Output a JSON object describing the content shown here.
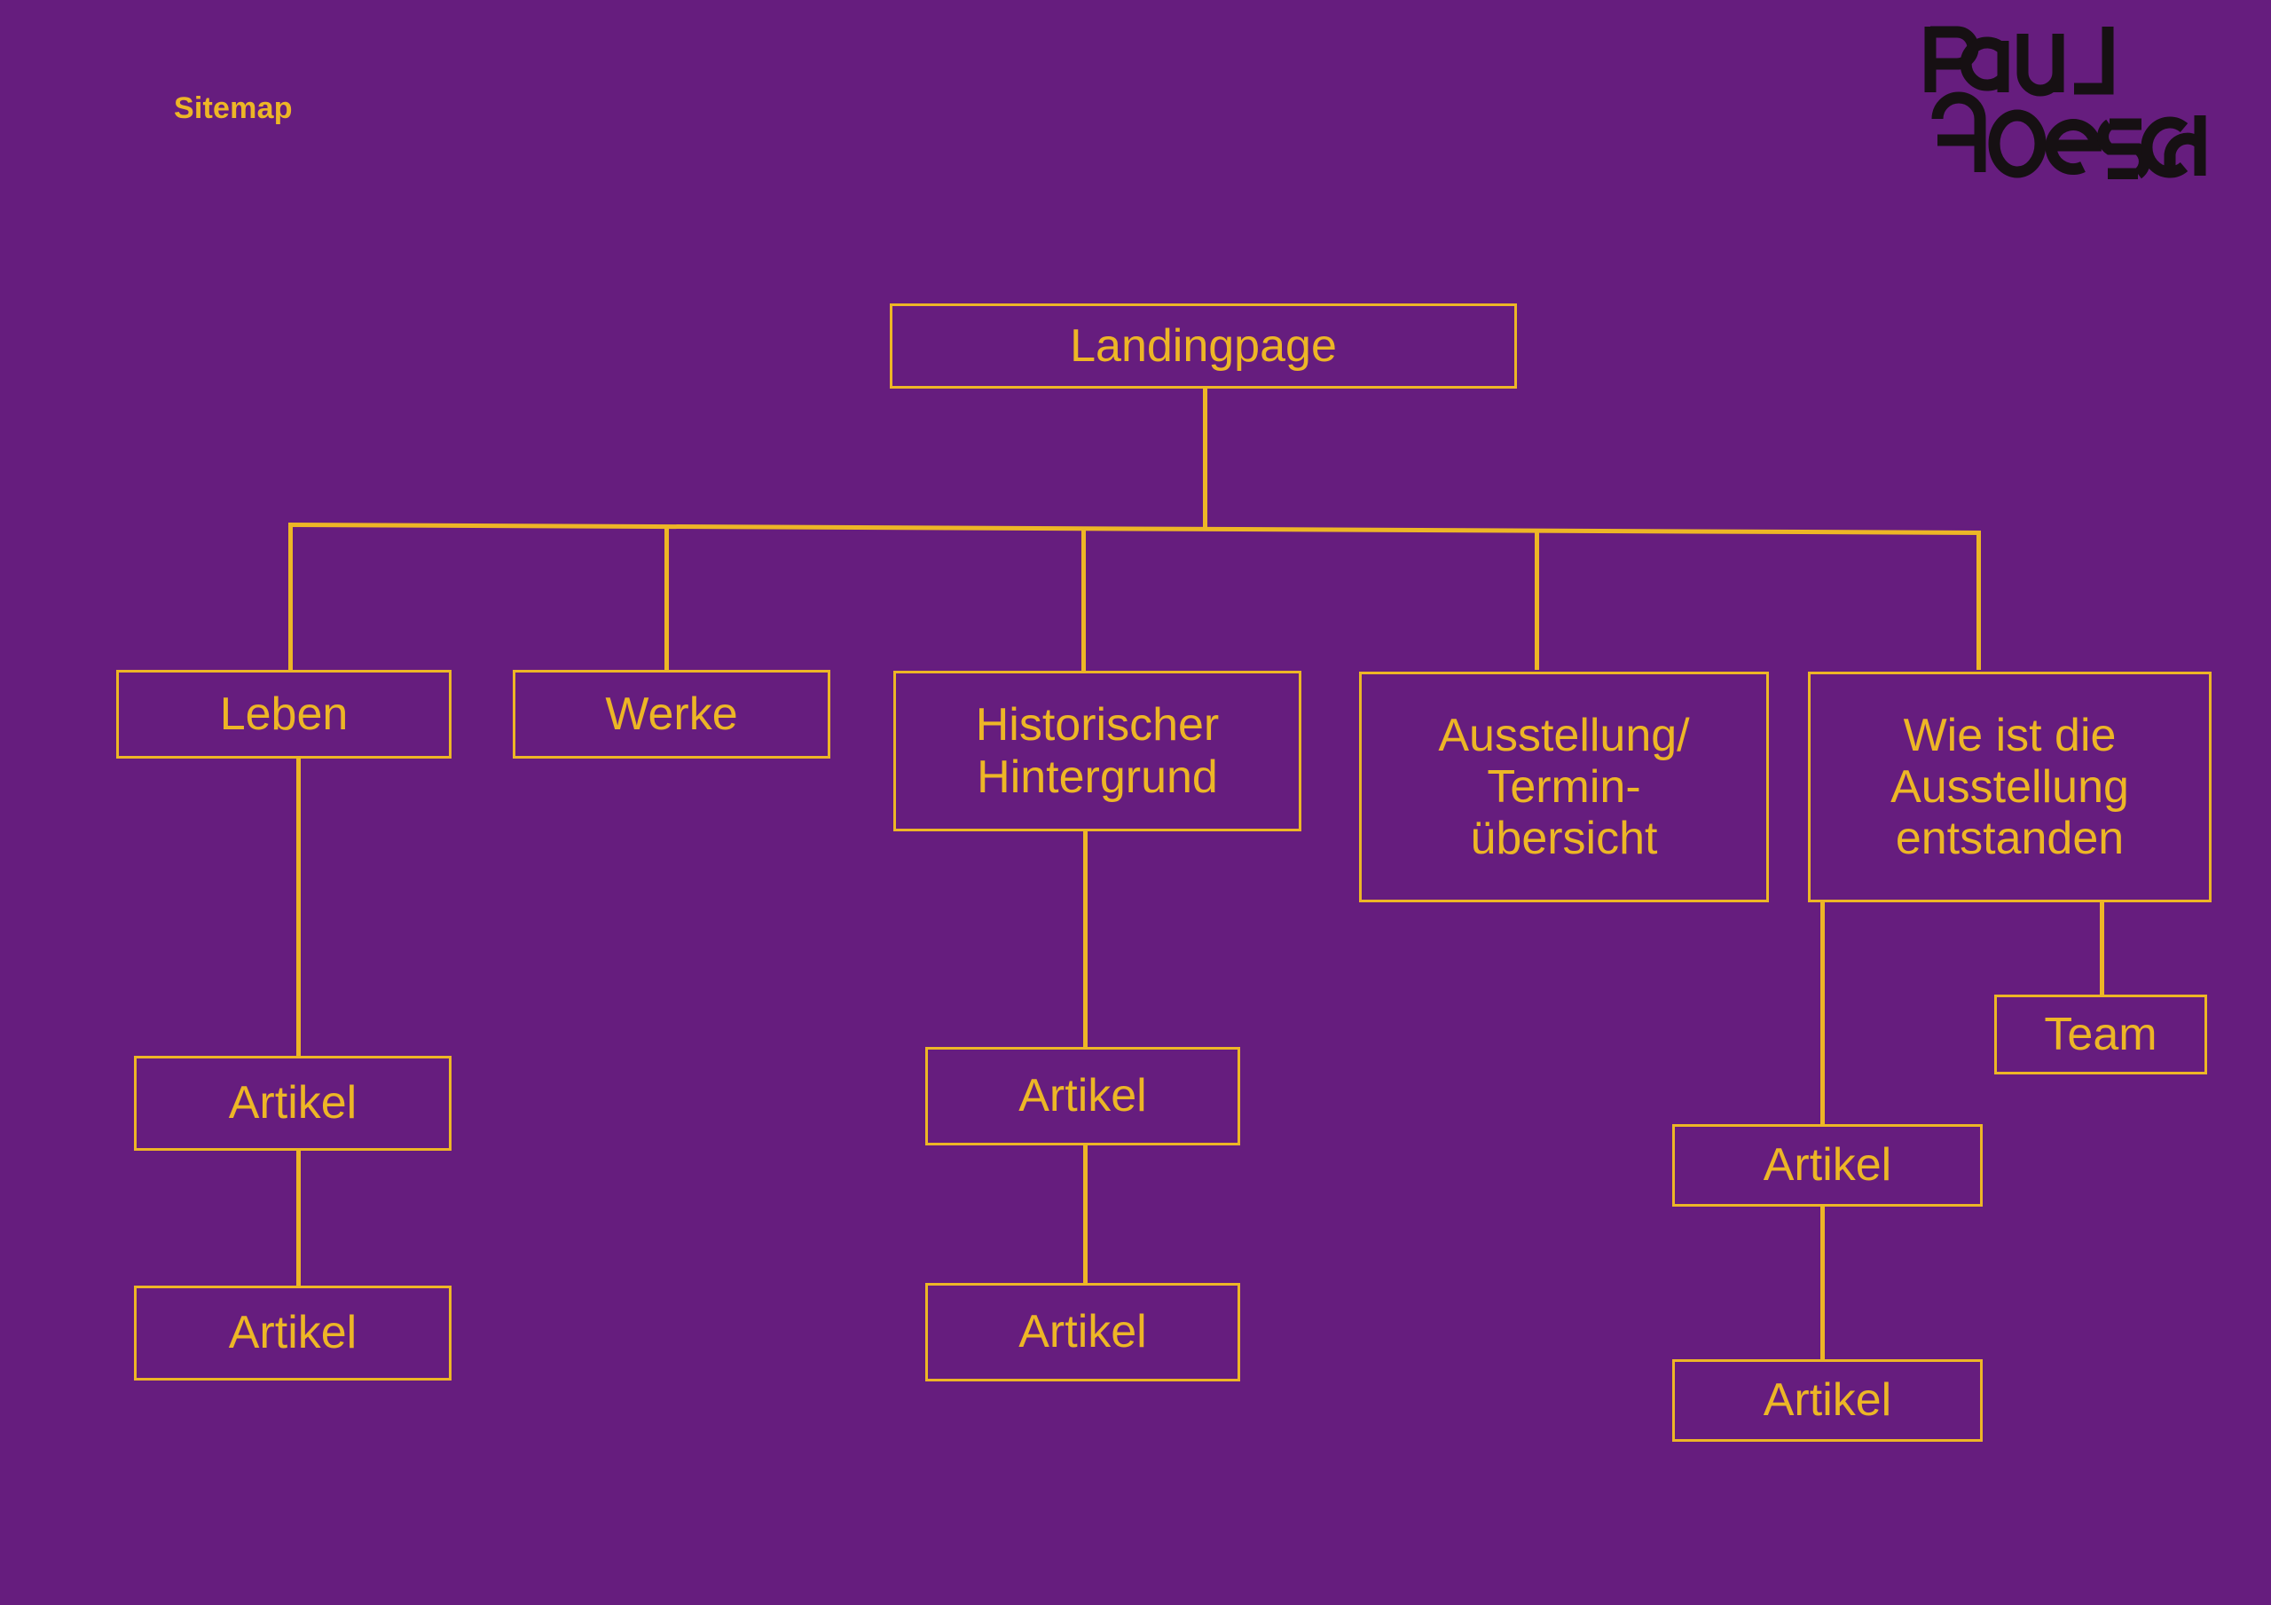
{
  "page": {
    "title": "Sitemap",
    "background_color": "#661d7e",
    "accent_color": "#edb626"
  },
  "header": {
    "section_label": "Sitemap",
    "logo": {
      "name": "paul-goesch-logo",
      "line1": "PAUL",
      "line2": "GOESCH",
      "color": "#161013"
    }
  },
  "sitemap": {
    "root": {
      "label": "Landingpage"
    },
    "level1": [
      {
        "id": "leben",
        "label": "Leben"
      },
      {
        "id": "werke",
        "label": "Werke"
      },
      {
        "id": "historischer-hintergrund",
        "label": "Historischer\nHintergrund"
      },
      {
        "id": "ausstellung-terminuebersicht",
        "label": "Ausstellung/\nTermin-\nübersicht"
      },
      {
        "id": "wie-ist-die-ausstellung-entstanden",
        "label": "Wie ist die\nAusstellung\nentstanden"
      }
    ],
    "children": {
      "leben": [
        {
          "id": "leben-artikel-1",
          "label": "Artikel"
        },
        {
          "id": "leben-artikel-2",
          "label": "Artikel"
        }
      ],
      "werke": [],
      "historischer-hintergrund": [
        {
          "id": "hist-artikel-1",
          "label": "Artikel"
        },
        {
          "id": "hist-artikel-2",
          "label": "Artikel"
        }
      ],
      "ausstellung-terminuebersicht": [],
      "wie-ist-die-ausstellung-entstanden": [
        {
          "id": "team",
          "label": "Team"
        },
        {
          "id": "wie-artikel-1",
          "label": "Artikel"
        },
        {
          "id": "wie-artikel-2",
          "label": "Artikel"
        }
      ]
    }
  },
  "chart_data": {
    "type": "diagram",
    "diagram_kind": "sitemap-tree",
    "title": "Sitemap",
    "nodes": [
      {
        "id": "landingpage",
        "label": "Landingpage",
        "depth": 0,
        "parent": null
      },
      {
        "id": "leben",
        "label": "Leben",
        "depth": 1,
        "parent": "landingpage"
      },
      {
        "id": "werke",
        "label": "Werke",
        "depth": 1,
        "parent": "landingpage"
      },
      {
        "id": "historischer-hintergrund",
        "label": "Historischer Hintergrund",
        "depth": 1,
        "parent": "landingpage"
      },
      {
        "id": "ausstellung-terminuebersicht",
        "label": "Ausstellung/ Termin-übersicht",
        "depth": 1,
        "parent": "landingpage"
      },
      {
        "id": "wie-ist-die-ausstellung-entstanden",
        "label": "Wie ist die Ausstellung entstanden",
        "depth": 1,
        "parent": "landingpage"
      },
      {
        "id": "leben-artikel-1",
        "label": "Artikel",
        "depth": 2,
        "parent": "leben"
      },
      {
        "id": "leben-artikel-2",
        "label": "Artikel",
        "depth": 3,
        "parent": "leben-artikel-1"
      },
      {
        "id": "hist-artikel-1",
        "label": "Artikel",
        "depth": 2,
        "parent": "historischer-hintergrund"
      },
      {
        "id": "hist-artikel-2",
        "label": "Artikel",
        "depth": 3,
        "parent": "hist-artikel-1"
      },
      {
        "id": "team",
        "label": "Team",
        "depth": 2,
        "parent": "wie-ist-die-ausstellung-entstanden"
      },
      {
        "id": "wie-artikel-1",
        "label": "Artikel",
        "depth": 2,
        "parent": "wie-ist-die-ausstellung-entstanden"
      },
      {
        "id": "wie-artikel-2",
        "label": "Artikel",
        "depth": 3,
        "parent": "wie-artikel-1"
      }
    ],
    "node_count": 13,
    "max_depth": 3,
    "colors": {
      "background": "#661d7e",
      "stroke": "#edb626",
      "text": "#edb626"
    }
  }
}
